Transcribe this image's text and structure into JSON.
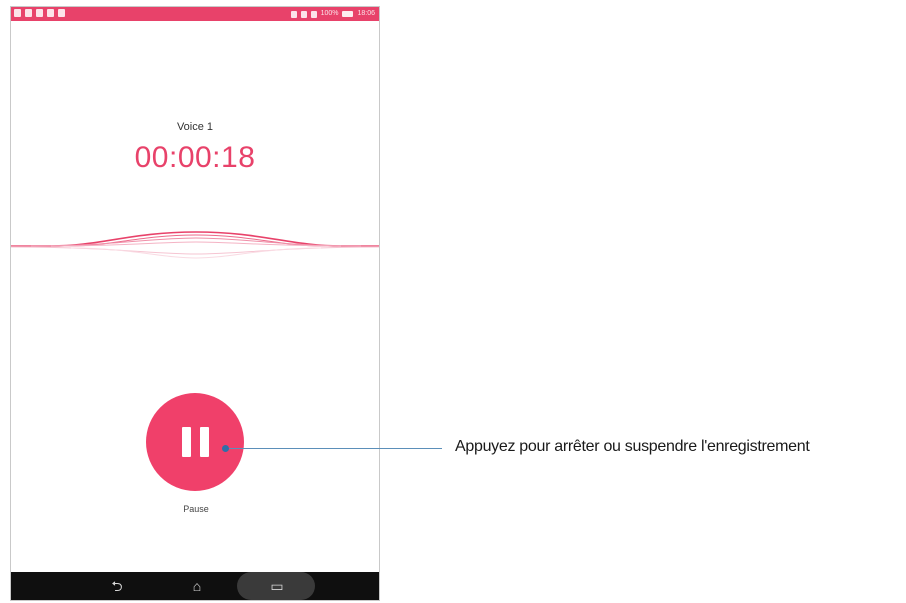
{
  "recorder": {
    "title": "Voice 1",
    "elapsed_time": "00:00:18",
    "pause_label": "Pause",
    "accent_color": "#e8426a"
  },
  "status_bar": {
    "battery": "100%",
    "clock": "18:06"
  },
  "nav": {
    "back_glyph": "⮌",
    "home_glyph": "⌂",
    "recent_glyph": "▭"
  },
  "callout": {
    "text": "Appuyez pour arrêter ou suspendre l'enregistrement"
  },
  "icons": {
    "pause": "pause-icon",
    "back": "back-icon",
    "home": "home-icon",
    "recent": "recent-apps-icon"
  }
}
